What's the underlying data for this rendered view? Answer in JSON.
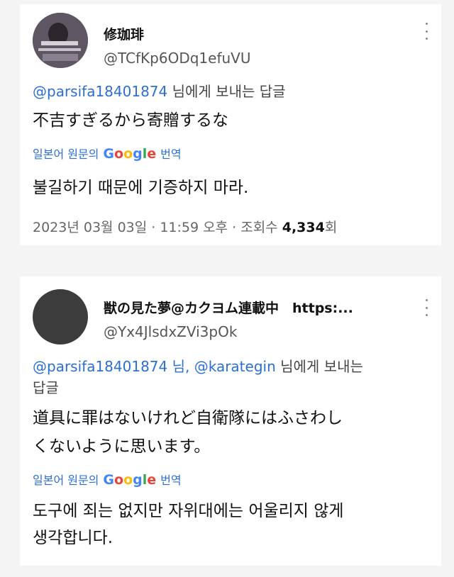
{
  "tweets": [
    {
      "display_name": "修珈琲",
      "handle": "@TCfKp6ODq1efuVU",
      "reply_mentions": "@parsifa18401874",
      "reply_suffix": "님에게 보내는 답글",
      "text": "不吉すぎるから寄贈するな",
      "translate_prefix": "일본어 원문의",
      "translate_suffix": "번역",
      "translated": "불길하기 때문에 기증하지 마라.",
      "meta_time": "2023년 03월 03일 · 11:59 오후 · 조회수",
      "meta_views": "4,334",
      "meta_views_suffix": "회"
    },
    {
      "display_name": "獣の見た夢@カクヨム連載中　https:...",
      "handle": "@Yx4JlsdxZVi3pOk",
      "reply_mentions": "@parsifa18401874 님, @karategin",
      "reply_suffix": "님에게 보내는",
      "reply_line2": "답글",
      "text_line1": "道具に罪はないけれど自衛隊にはふさわし",
      "text_line2": "くないように思います。",
      "translate_prefix": "일본어 원문의",
      "translate_suffix": "번역",
      "translated_line1": "도구에 죄는 없지만 자위대에는 어울리지 않게",
      "translated_line2": "생각합니다."
    }
  ],
  "google_logo": [
    "G",
    "o",
    "o",
    "g",
    "l",
    "e"
  ],
  "colors": {
    "link": "#2b6fd6",
    "background": "#f4f4f4",
    "card": "#ffffff"
  },
  "icons": [
    "more-options-icon"
  ]
}
